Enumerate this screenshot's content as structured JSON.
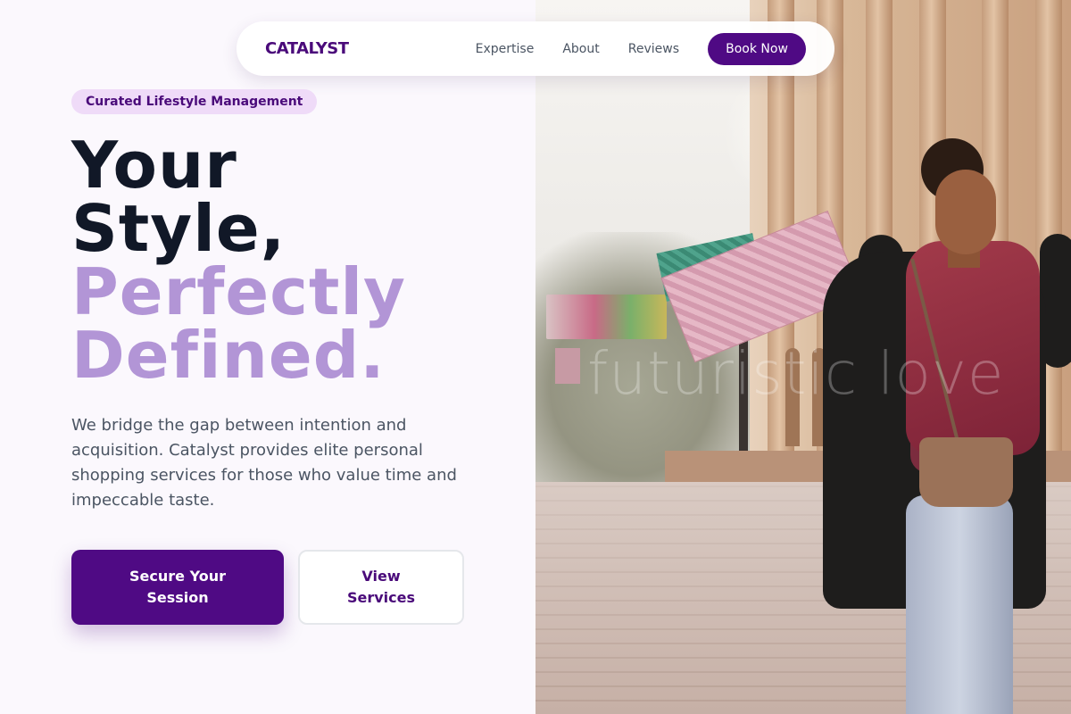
{
  "nav": {
    "brand": "CATALYST",
    "links": [
      "Expertise",
      "About",
      "Reviews"
    ],
    "cta": "Book Now"
  },
  "hero": {
    "badge": "Curated Lifestyle Management",
    "headline_line1": "Your",
    "headline_line2": "Style,",
    "headline_accent_line1": "Perfectly",
    "headline_accent_line2": "Defined.",
    "description": "We bridge the gap between intention and acquisition. Catalyst provides elite personal shopping services for those who value time and impeccable taste.",
    "primary_button": "Secure Your Session",
    "secondary_button": "View Services"
  },
  "image": {
    "watermark": "futuristic love"
  },
  "colors": {
    "brand_purple": "#4f0a84",
    "accent_lavender": "#b295d6",
    "badge_bg": "#efdbf8",
    "heading_dark": "#111827"
  }
}
